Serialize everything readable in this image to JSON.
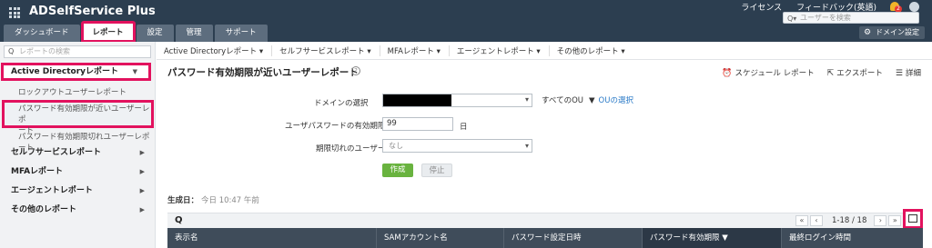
{
  "app": {
    "brand": "ADSelfService Plus"
  },
  "top_links": {
    "license": "ライセンス",
    "feedback": "フィードバック(英語)",
    "badge": "2"
  },
  "top_search": {
    "placeholder": "ユーザーを検索"
  },
  "nav_tabs": [
    {
      "label": "ダッシュボード",
      "active": false
    },
    {
      "label": "レポート",
      "active": true
    },
    {
      "label": "設定",
      "active": false
    },
    {
      "label": "管理",
      "active": false
    },
    {
      "label": "サポート",
      "active": false
    }
  ],
  "domain_settings_label": "ドメイン設定",
  "sidebar": {
    "search_placeholder": "レポートの検索",
    "groups": [
      {
        "label": "Active Directoryレポート",
        "expanded": true
      },
      {
        "label": "セルフサービスレポート"
      },
      {
        "label": "MFAレポート"
      },
      {
        "label": "エージェントレポート"
      },
      {
        "label": "その他のレポート"
      }
    ],
    "items": [
      {
        "label": "ロックアウトユーザーレポート"
      },
      {
        "label": "パスワード有効期限が近いユーザーレポート",
        "label_line1": "パスワード有効期限が近いユーザーレポ",
        "label_line2": "ート",
        "selected": true
      },
      {
        "label": "パスワード有効期限切れユーザーレポート"
      }
    ]
  },
  "subnav": [
    "Active Directoryレポート ▾",
    "セルフサービスレポート ▾",
    "MFAレポート ▾",
    "エージェントレポート ▾",
    "その他のレポート ▾"
  ],
  "page": {
    "title": "パスワード有効期限が近いユーザーレポート",
    "help": "?",
    "actions": {
      "schedule": "スケジュール レポート",
      "export": "エクスポート",
      "details": "詳細"
    }
  },
  "form": {
    "domain_label": "ドメインの選択",
    "ou_all": "すべてのOU",
    "ou_select": "OUの選択",
    "days_label": "ユーザパスワードの有効期限",
    "days_value": "99",
    "days_unit": "日",
    "expiry_label": "期限切れのユーザー",
    "expiry_value": "なし",
    "create_btn": "作成",
    "stop_btn": "停止"
  },
  "generated": {
    "label": "生成日：",
    "time": "今日 10:47 午前"
  },
  "pager": {
    "first": "«",
    "prev": "‹",
    "range": "1-18 / 18",
    "next": "›",
    "last": "»"
  },
  "table": {
    "columns": [
      "表示名",
      "SAMアカウント名",
      "パスワード設定日時",
      "パスワード有効期限 ▼",
      "最終ログイン時間"
    ],
    "sorted_column": "パスワード有効期限"
  }
}
